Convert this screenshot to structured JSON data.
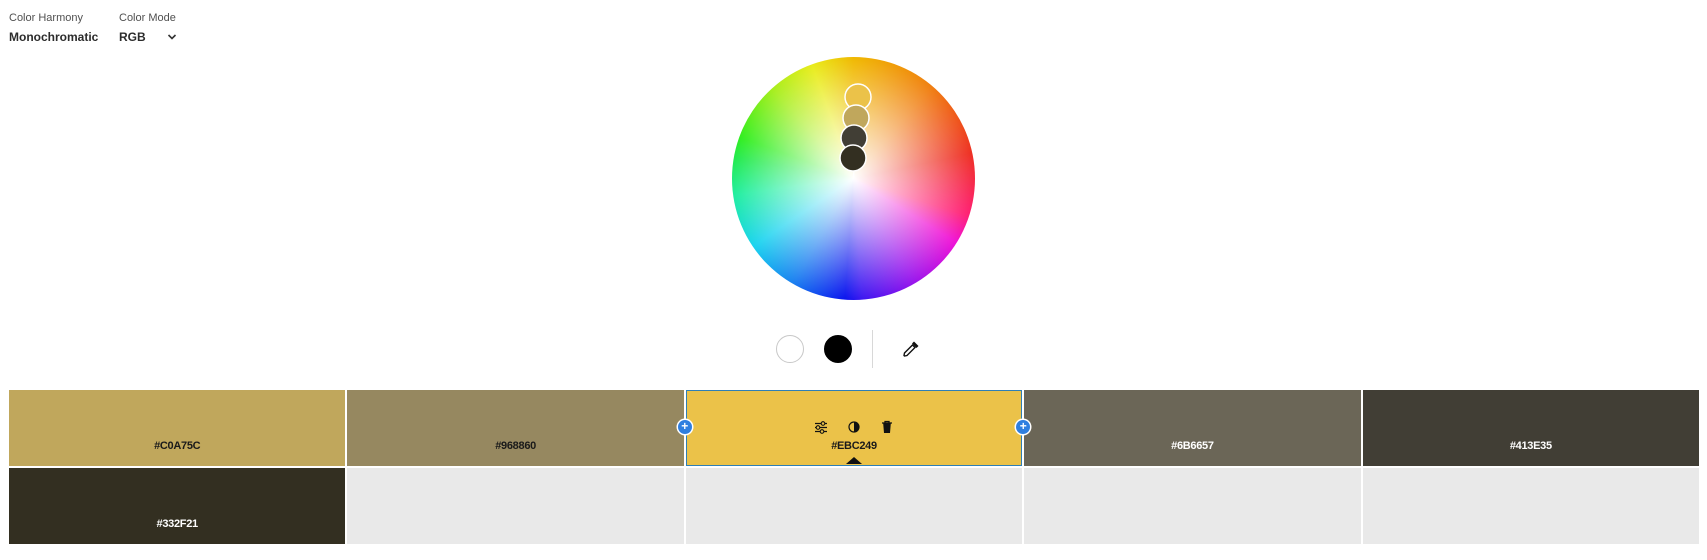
{
  "controls": {
    "harmony": {
      "label": "Color Harmony",
      "value": "Monochromatic"
    },
    "mode": {
      "label": "Color Mode",
      "value": "RGB"
    }
  },
  "wheel": {
    "picker_colors": [
      "#EBC249",
      "#C0A75C",
      "#413E35",
      "#332F21"
    ]
  },
  "tools": {
    "white_swatch": "#FFFFFF",
    "black_swatch": "#000000",
    "eyedropper_icon": "eyedropper-icon"
  },
  "swatches": {
    "row1": [
      {
        "hex": "#C0A75C",
        "color": "#C0A75C",
        "text_color": "#1a1a1a"
      },
      {
        "hex": "#968860",
        "color": "#968860",
        "text_color": "#1a1a1a"
      },
      {
        "hex": "#EBC249",
        "color": "#EBC249",
        "text_color": "#1a1a1a",
        "selected": true
      },
      {
        "hex": "#6B6657",
        "color": "#6B6657",
        "text_color": "#ffffff"
      },
      {
        "hex": "#413E35",
        "color": "#413E35",
        "text_color": "#ffffff"
      }
    ],
    "row2": [
      {
        "hex": "#332F21",
        "color": "#332F21",
        "text_color": "#ffffff"
      }
    ],
    "actions": [
      "adjust-icon",
      "contrast-icon",
      "trash-icon"
    ],
    "add_symbol": "+"
  }
}
